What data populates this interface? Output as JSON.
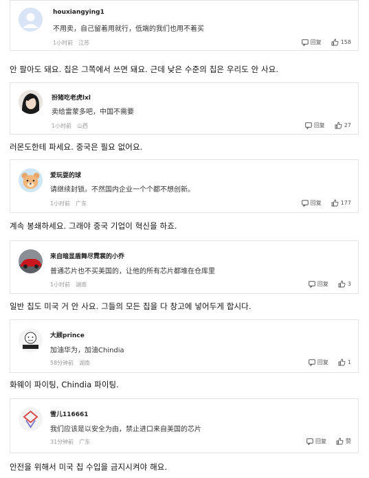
{
  "comments": [
    {
      "username": "houxiangying1",
      "text": "不用卖，自己留着用就行，低端的我们也用不着买",
      "time": "1小时前",
      "location": "江苏",
      "reply_label": "回复",
      "likes": "158",
      "avatar_icon": "default-user-icon"
    },
    {
      "username": "扮猪吃老虎lxl",
      "text": "卖给雷蒙多吧，中国不需要",
      "time": "1小时前",
      "location": "山西",
      "reply_label": "回复",
      "likes": "27",
      "avatar_icon": "woman-photo-avatar"
    },
    {
      "username": "爱玩耍的球",
      "text": "请继续封锁。不然国内企业一个个都不想创新。",
      "time": "1小时前",
      "location": "广东",
      "reply_label": "回复",
      "likes": "177",
      "avatar_icon": "cartoon-bear-avatar"
    },
    {
      "username": "来自暗显盾舞尽霓裳的小乔",
      "text": "普通芯片也不买美国的，让他的所有芯片都堆在仓库里",
      "time": "1小时前",
      "location": "湖南",
      "reply_label": "回复",
      "likes": "3",
      "avatar_icon": "red-car-avatar"
    },
    {
      "username": "大顾prince",
      "text": "加油华为，加油Chindia",
      "time": "58分钟前",
      "location": "湖南",
      "reply_label": "回复",
      "likes": "1",
      "avatar_icon": "cartoon-sticker-avatar"
    },
    {
      "username": "雪儿116661",
      "text": "我们应该是以安全为由，禁止进口来自美国的芯片",
      "time": "31分钟前",
      "location": "广东",
      "reply_label": "回复",
      "likes": "赞",
      "avatar_icon": "geometric-logo-avatar"
    }
  ],
  "translations": [
    "안 팔아도 돼요. 칩은 그쪽에서 쓰면 돼요. 근데 낮은 수준의 칩은 우리도 안 사요.",
    "러몬도한테 파세요. 중국은 필요 없어요.",
    "계속 봉쇄하세요. 그래야 중국 기업이 혁신을 하죠.",
    "일반 칩도 미국 거 안 사요. 그들의 모든 칩을 다 창고에 넣어두게 합시다.",
    "화웨이 파이팅, Chindia 파이팅.",
    "안전을 위해서 미국 칩 수입을 금지시켜야 해요."
  ]
}
